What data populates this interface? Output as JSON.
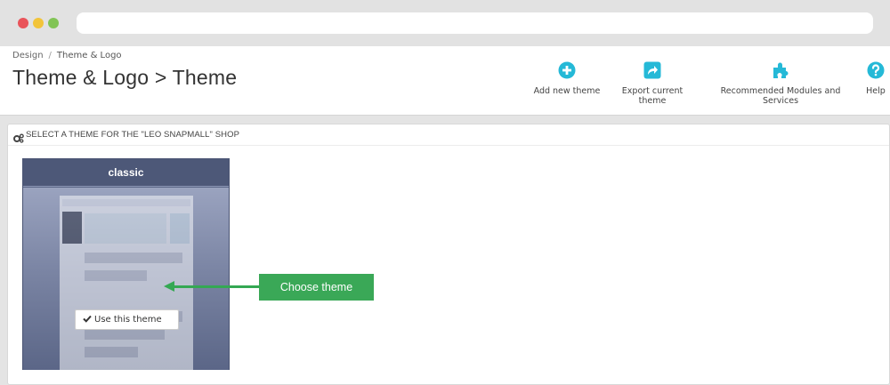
{
  "breadcrumb": {
    "parent": "Design",
    "separator": "/",
    "current": "Theme & Logo"
  },
  "page_title": "Theme & Logo > Theme",
  "toolbar": {
    "add_new_theme": "Add new theme",
    "export_current_theme": "Export current theme",
    "recommended": "Recommended Modules and Services",
    "help": "Help",
    "icon_color": "#25b9d7"
  },
  "panel": {
    "heading": "SELECT A THEME FOR THE \"LEO SNAPMALL\" SHOP"
  },
  "theme": {
    "name": "classic",
    "use_button": "Use this theme"
  },
  "annotation": {
    "callout": "Choose theme",
    "color": "#3aa857"
  }
}
